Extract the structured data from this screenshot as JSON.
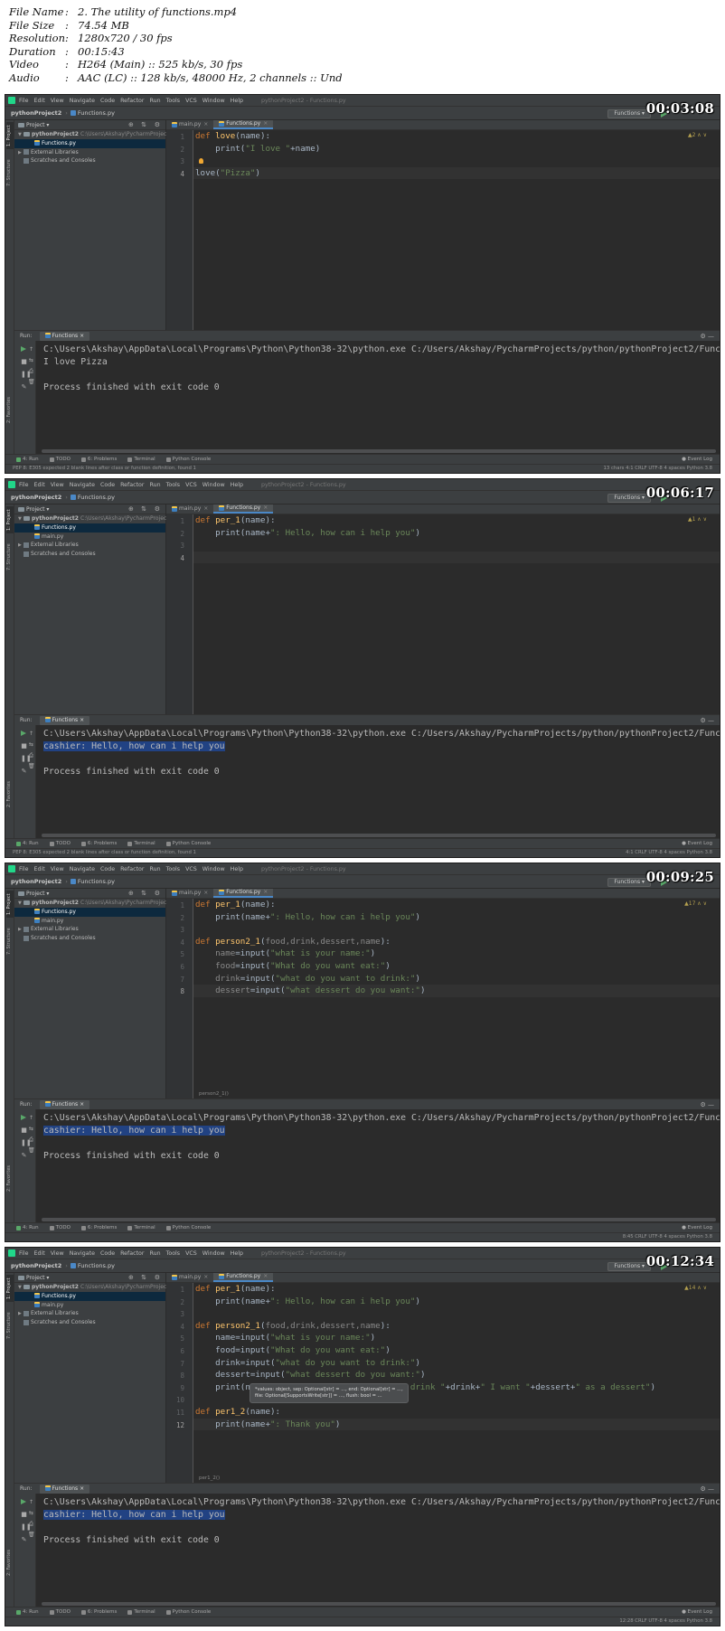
{
  "file_info": [
    {
      "key": "File Name",
      "value": "2. The utility of functions.mp4"
    },
    {
      "key": "File Size",
      "value": "74.54 MB"
    },
    {
      "key": "Resolution",
      "value": "1280x720 / 30 fps"
    },
    {
      "key": "Duration",
      "value": "00:15:43"
    },
    {
      "key": "Video",
      "value": "H264 (Main) :: 525 kb/s, 30 fps"
    },
    {
      "key": "Audio",
      "value": "AAC (LC) :: 128 kb/s, 48000 Hz, 2 channels :: Und"
    }
  ],
  "menu": [
    "File",
    "Edit",
    "View",
    "Navigate",
    "Code",
    "Refactor",
    "Run",
    "Tools",
    "VCS",
    "Window",
    "Help"
  ],
  "window_title": "pythonProject2 - Functions.py",
  "project_name": "pythonProject2",
  "current_file": "Functions.py",
  "run_config": "Functions",
  "project_panel_label": "Project",
  "project_path": "C:\\Users\\Akshay\\PycharmProjects",
  "external_libraries": "External Libraries",
  "scratches": "Scratches and Consoles",
  "run_label": "Run:",
  "run_tab": "Functions",
  "toolwin": {
    "run": "4: Run",
    "todo": "TODO",
    "problems": "6: Problems",
    "terminal": "Terminal",
    "console": "Python Console",
    "event_log": "Event Log"
  },
  "side_tabs": {
    "project": "1: Project",
    "structure": "7: Structure",
    "favorites": "2: Favorites"
  },
  "frames": [
    {
      "timestamp": "00:03:08",
      "tabs": [
        "main.py",
        "Functions.py"
      ],
      "tree": [
        "pythonProject2",
        "Functions.py"
      ],
      "warning": "▲2",
      "line_numbers": [
        "1",
        "2",
        "3",
        "4"
      ],
      "code_lines": [
        [
          [
            "kw",
            "def "
          ],
          [
            "fn",
            "love"
          ],
          [
            "",
            "(name):"
          ]
        ],
        [
          [
            "",
            "    print("
          ],
          [
            "str",
            "\"I love \""
          ],
          [
            "",
            "+name)"
          ]
        ],
        [
          [
            "",
            ""
          ]
        ],
        [
          [
            "",
            "love("
          ],
          [
            "str",
            "\"Pizza\""
          ],
          [
            "",
            ")"
          ]
        ]
      ],
      "console": [
        "C:\\Users\\Akshay\\AppData\\Local\\Programs\\Python\\Python38-32\\python.exe C:/Users/Akshay/PycharmProjects/python/pythonProject2/Functi",
        "I love Pizza",
        "",
        "Process finished with exit code 0"
      ],
      "status_left": "PEP 8: E305 expected 2 blank lines after class or function definition, found 1",
      "status_right": "13 chars   4:1   CRLF   UTF-8   4 spaces   Python 3.8"
    },
    {
      "timestamp": "00:06:17",
      "tabs": [
        "main.py",
        "Functions.py"
      ],
      "tree": [
        "pythonProject2",
        "Functions.py",
        "main.py"
      ],
      "warning": "▲1",
      "line_numbers": [
        "1",
        "2",
        "3",
        "4"
      ],
      "code_lines": [
        [
          [
            "kw",
            "def "
          ],
          [
            "fn",
            "per_1"
          ],
          [
            "",
            "(name):"
          ]
        ],
        [
          [
            "",
            "    print(name+"
          ],
          [
            "str",
            "\": Hello, how can i help you\""
          ],
          [
            "",
            ")"
          ]
        ],
        [
          [
            "",
            ""
          ]
        ],
        [
          [
            "",
            ""
          ]
        ]
      ],
      "console": [
        "C:\\Users\\Akshay\\AppData\\Local\\Programs\\Python\\Python38-32\\python.exe C:/Users/Akshay/PycharmProjects/python/pythonProject2/Functi",
        "cashier: Hello, how can i help you",
        "",
        "Process finished with exit code 0"
      ],
      "status_left": "PEP 8: E305 expected 2 blank lines after class or function definition, found 1",
      "status_right": "4:1   CRLF   UTF-8   4 spaces   Python 3.8"
    },
    {
      "timestamp": "00:09:25",
      "tabs": [
        "main.py",
        "Functions.py"
      ],
      "tree": [
        "pythonProject2",
        "Functions.py",
        "main.py"
      ],
      "warning": "▲17",
      "line_numbers": [
        "1",
        "2",
        "3",
        "4",
        "5",
        "6",
        "7",
        "8"
      ],
      "code_lines": [
        [
          [
            "kw",
            "def "
          ],
          [
            "fn",
            "per_1"
          ],
          [
            "",
            "(name):"
          ]
        ],
        [
          [
            "",
            "    print(name+"
          ],
          [
            "str",
            "\": Hello, how can i help you\""
          ],
          [
            "",
            ")"
          ]
        ],
        [
          [
            "",
            ""
          ]
        ],
        [
          [
            "kw",
            "def "
          ],
          [
            "fn",
            "person2_1"
          ],
          [
            "",
            "("
          ],
          [
            "dim",
            "food,drink,dessert,name"
          ],
          [
            "",
            "):"
          ]
        ],
        [
          [
            "dim",
            "    name"
          ],
          [
            "",
            "=input("
          ],
          [
            "str",
            "\"what is your name:\""
          ],
          [
            "",
            ")"
          ]
        ],
        [
          [
            "dim",
            "    food"
          ],
          [
            "",
            "=input("
          ],
          [
            "str",
            "\"What do you want eat:\""
          ],
          [
            "",
            ")"
          ]
        ],
        [
          [
            "dim",
            "    drink"
          ],
          [
            "",
            "=input("
          ],
          [
            "str",
            "\"what do you want to drink:\""
          ],
          [
            "",
            ")"
          ]
        ],
        [
          [
            "dim",
            "    dessert"
          ],
          [
            "",
            "=input("
          ],
          [
            "str",
            "\"what dessert do you want:\""
          ],
          [
            "",
            ")"
          ]
        ]
      ],
      "breadcrumb": "person2_1()",
      "console": [
        "C:\\Users\\Akshay\\AppData\\Local\\Programs\\Python\\Python38-32\\python.exe C:/Users/Akshay/PycharmProjects/python/pythonProject2/Functi",
        "cashier: Hello, how can i help you",
        "",
        "Process finished with exit code 0"
      ],
      "status_left": "",
      "status_right": "8:45   CRLF   UTF-8   4 spaces   Python 3.8"
    },
    {
      "timestamp": "00:12:34",
      "tabs": [
        "main.py",
        "Functions.py"
      ],
      "tree": [
        "pythonProject2",
        "Functions.py",
        "main.py"
      ],
      "warning": "▲14",
      "line_numbers": [
        "1",
        "2",
        "3",
        "4",
        "5",
        "6",
        "7",
        "8",
        "9",
        "10",
        "11",
        "12"
      ],
      "code_lines": [
        [
          [
            "kw",
            "def "
          ],
          [
            "fn",
            "per_1"
          ],
          [
            "",
            "(name):"
          ]
        ],
        [
          [
            "",
            "    print(name+"
          ],
          [
            "str",
            "\": Hello, how can i help you\""
          ],
          [
            "",
            ")"
          ]
        ],
        [
          [
            "",
            ""
          ]
        ],
        [
          [
            "kw",
            "def "
          ],
          [
            "fn",
            "person2_1"
          ],
          [
            "",
            "("
          ],
          [
            "dim",
            "food,drink,dessert,name"
          ],
          [
            "",
            "):"
          ]
        ],
        [
          [
            "",
            "    name=input("
          ],
          [
            "str",
            "\"what is your name:\""
          ],
          [
            "",
            ")"
          ]
        ],
        [
          [
            "",
            "    food=input("
          ],
          [
            "str",
            "\"What do you want eat:\""
          ],
          [
            "",
            ")"
          ]
        ],
        [
          [
            "",
            "    drink=input("
          ],
          [
            "str",
            "\"what do you want to drink:\""
          ],
          [
            "",
            ")"
          ]
        ],
        [
          [
            "",
            "    dessert=input("
          ],
          [
            "str",
            "\"what dessert do you want:\""
          ],
          [
            "",
            ")"
          ]
        ],
        [
          [
            "",
            "    print(na"
          ],
          [
            "str",
            "                          want drink \""
          ],
          [
            "",
            "+drink+"
          ],
          [
            "str",
            "\" I want \""
          ],
          [
            "",
            "+dessert+"
          ],
          [
            "str",
            "\" as a dessert\""
          ],
          [
            "",
            ")"
          ]
        ],
        [
          [
            "",
            ""
          ]
        ],
        [
          [
            "kw",
            "def "
          ],
          [
            "fn",
            "per1_2"
          ],
          [
            "",
            "(name):"
          ]
        ],
        [
          [
            "",
            "    print(name+"
          ],
          [
            "str",
            "\": Thank you\""
          ],
          [
            "",
            ")"
          ]
        ]
      ],
      "popup": "*values: object, sep: Optional[str] = ..., end: Optional[str] = ...,\nfile: Optional[SupportsWrite[str]] = ..., flush: bool = ...",
      "breadcrumb": "per1_2()",
      "console": [
        "C:\\Users\\Akshay\\AppData\\Local\\Programs\\Python\\Python38-32\\python.exe C:/Users/Akshay/PycharmProjects/python/pythonProject2/Functi",
        "cashier: Hello, how can i help you",
        "",
        "Process finished with exit code 0"
      ],
      "status_left": "",
      "status_right": "12:28   CRLF   UTF-8   4 spaces   Python 3.8"
    }
  ]
}
